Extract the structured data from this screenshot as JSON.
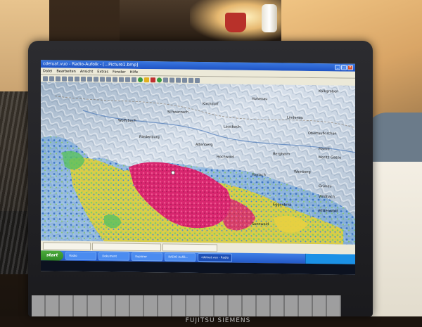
{
  "window": {
    "title": "cdeluat.vuo - Radio-Aufolk - [...Picture1.bmp]",
    "buttons": [
      "_",
      "□",
      "×"
    ]
  },
  "menubar": {
    "items": [
      "Datei",
      "Bearbeiten",
      "Ansicht",
      "Extras",
      "Fenster",
      "Hilfe"
    ]
  },
  "taskbar": {
    "start_label": "start",
    "tasks": [
      "Radio",
      "Dokument",
      "Explorer",
      "RADIO Auflö...",
      "cdeluat.vuo - Radio"
    ]
  },
  "laptop": {
    "brand": "FUJITSU SIEMENS"
  },
  "colors": {
    "coverage_strong": "#e0307a",
    "coverage_mid": "#e8d040",
    "coverage_weak": "#3a8ad8",
    "coverage_green": "#59c060",
    "terrain": "#c8d4e2"
  },
  "map_labels": [
    "Kalkgraben",
    "Hohenau",
    "Kirchdorf",
    "Schwarzach",
    "Wolfsbach",
    "Lindenau",
    "Obertaufkirchen",
    "Lausbach",
    "Riedenburg",
    "Marktl",
    "Moritz Gasse",
    "Bergheim",
    "Weinberg",
    "Haslach",
    "Grünau",
    "Wildbach",
    "Eggenfeld",
    "Mittenwald",
    "Hochwald",
    "Altenberg",
    "Sonnwald"
  ]
}
